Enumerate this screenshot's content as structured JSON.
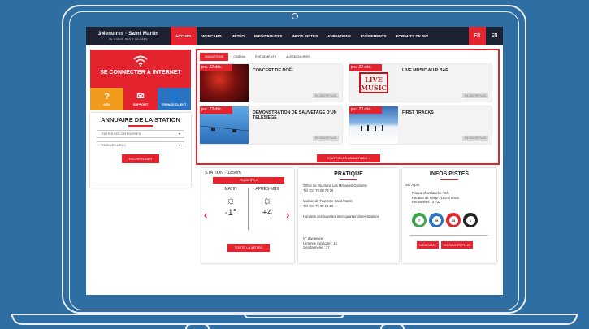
{
  "nav": {
    "logo_line1": "3Menuires · Saint Martin",
    "logo_line2": "LE COEUR DES 3 VALLÉES",
    "items": [
      "ACCUEIL",
      "WEBCAMS",
      "MÉTÉO",
      "INFOS ROUTES",
      "INFOS PISTES",
      "ANIMATIONS",
      "ÉVÈNEMENTS",
      "FORFAITS DE SKI"
    ],
    "active_item": "ACCUEIL",
    "languages": [
      "FR",
      "EN"
    ],
    "active_language": "FR"
  },
  "wifi": {
    "label": "SE CONNECTER À INTERNET",
    "tiles": [
      {
        "icon": "?",
        "label": "AIDE"
      },
      {
        "icon": "✉",
        "label": "SUPPORT"
      },
      {
        "icon": "👤",
        "label": "ESPACE CLIENT"
      }
    ]
  },
  "annuaire": {
    "title": "ANNUAIRE DE LA STATION",
    "select_category": "TOUTES LES CATÉGORIES",
    "select_place": "TOUS LES LIEUX",
    "search_button": "RECHERCHER"
  },
  "animations": {
    "tabs": [
      "ANIMATIONS",
      "CINÉMA",
      "ÉVÈNEMENTS",
      "#LESMENUIRES"
    ],
    "active_tab": "ANIMATIONS",
    "cards": [
      {
        "date": "jeu. 22 déc.",
        "title": "CONCERT DE NOËL",
        "more": "EN SAVOIR PLUS"
      },
      {
        "date": "jeu. 22 déc.",
        "title": "LIVE MUSIC AU P BAR",
        "more": "EN SAVOIR PLUS",
        "logo": "LIVE MUSIC"
      },
      {
        "date": "jeu. 22 déc.",
        "title": "DÉMONSTRATION DE SAUVETAGE D'UN TÉLÉSIÈGE",
        "more": "EN SAVOIR PLUS"
      },
      {
        "date": "jeu. 22 déc.",
        "title": "FIRST TRACKS",
        "more": "EN SAVOIR PLUS"
      }
    ],
    "all_button": "TOUTES LES ANIMATIONS »"
  },
  "weather": {
    "station": "STATION - 1850m",
    "today": "Aujourd'hui",
    "morning_label": "MATIN",
    "afternoon_label": "APRÈS-MIDI",
    "morning_temp": "-1°",
    "afternoon_temp": "+4",
    "button": "TOUTE LA MÉTÉO"
  },
  "pratique": {
    "title": "PRATIQUE",
    "office_1": "Office de Tourisme Les Menuires/Croisette",
    "office_1_tel": "Tél : 04 79 00 73 00",
    "office_2": "Maison du Tourisme Saint Martin",
    "office_2_tel": "Tél : 04 79 00 20 00",
    "shuttle": "Horaires des navettes inter-quartiers/inter-Stations",
    "emergency": "N° d'urgence :",
    "urgence": "Urgence médicale : 15",
    "gendarmerie": "Gendarmerie : 17"
  },
  "pistes": {
    "title": "INFOS PISTES",
    "subtitle": "Ski Alpin",
    "avalanche": "Risque d'avalanche : 2/5",
    "snow": "Hauteur de neige : 15cm/ 80cm",
    "lifts": "Remontées : 27/32",
    "counts": [
      {
        "value": "7",
        "color": "#3aa64a"
      },
      {
        "value": "29",
        "color": "#2a73c0"
      },
      {
        "value": "14",
        "color": "#e3232d"
      },
      {
        "value": "1",
        "color": "#222222"
      }
    ],
    "btn_webcams": "WEBCAMS",
    "btn_more": "EN SAVOIR PLUS"
  }
}
